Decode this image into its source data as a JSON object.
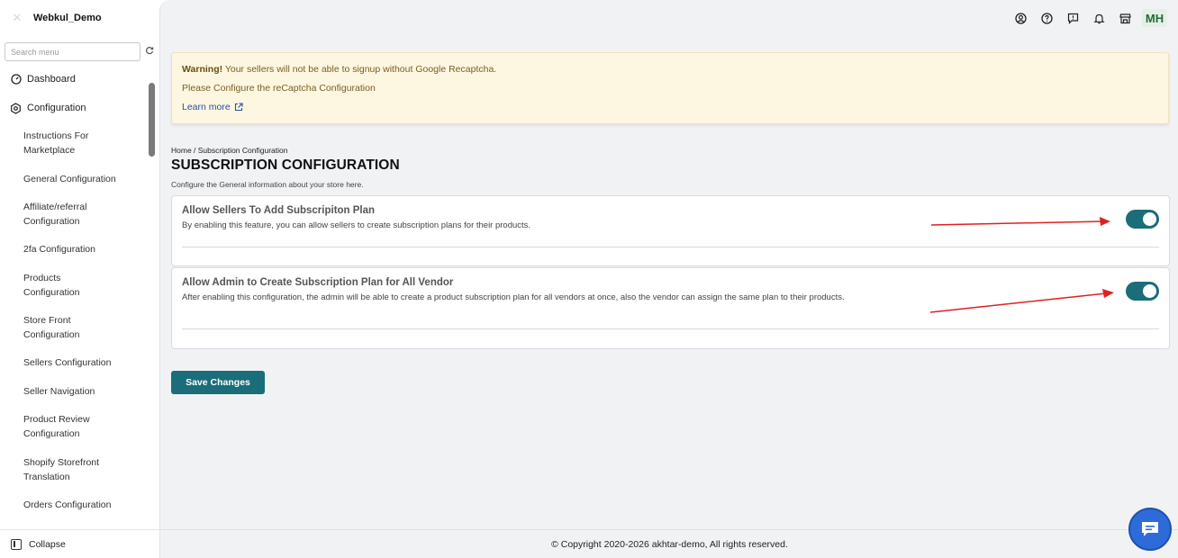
{
  "sidebar": {
    "brand": "Webkul_Demo",
    "search_placeholder": "Search menu",
    "top_items": [
      {
        "label": "Dashboard",
        "icon": "dashboard-icon"
      },
      {
        "label": "Configuration",
        "icon": "settings-hex-icon"
      }
    ],
    "sub_items": [
      {
        "label": "Instructions For\nMarketplace"
      },
      {
        "label": "General Configuration"
      },
      {
        "label": "Affiliate/referral\nConfiguration"
      },
      {
        "label": "2fa Configuration"
      },
      {
        "label": "Products\nConfiguration"
      },
      {
        "label": "Store Front\nConfiguration"
      },
      {
        "label": "Sellers Configuration"
      },
      {
        "label": "Seller Navigation"
      },
      {
        "label": "Product Review\nConfiguration"
      },
      {
        "label": "Shopify Storefront\nTranslation"
      },
      {
        "label": "Orders Configuration"
      }
    ],
    "collapse_label": "Collapse"
  },
  "header": {
    "avatar_initials": "MH",
    "icons": [
      "user-circle-icon",
      "help-circle-icon",
      "feedback-icon",
      "bell-icon",
      "store-icon"
    ]
  },
  "warning": {
    "strong": "Warning!",
    "line1": " Your sellers will not be able to signup without Google Recaptcha.",
    "line2": "Please Configure the reCaptcha Configuration",
    "link": "Learn more"
  },
  "page": {
    "breadcrumb": "Home / Subscription Configuration",
    "title": "SUBSCRIPTION CONFIGURATION",
    "description": "Configure the General information about your store here."
  },
  "settings": [
    {
      "title": "Allow Sellers To Add Subscripiton Plan",
      "description": "By enabling this feature, you can allow sellers to create subscription plans for their products.",
      "enabled": true
    },
    {
      "title": "Allow Admin to Create Subscription Plan for All Vendor",
      "description": "After enabling this configuration, the admin will be able to create a product subscription plan for all vendors at once, also the vendor can assign the same plan to their products.",
      "enabled": true
    }
  ],
  "actions": {
    "save_label": "Save Changes"
  },
  "footer": {
    "copyright": "© Copyright 2020-2026 akhtar-demo, All rights reserved."
  },
  "colors": {
    "accent": "#1a6d79",
    "warning_bg": "#fdf6e1",
    "arrow": "#e02020",
    "chat": "#2d6bd9"
  }
}
